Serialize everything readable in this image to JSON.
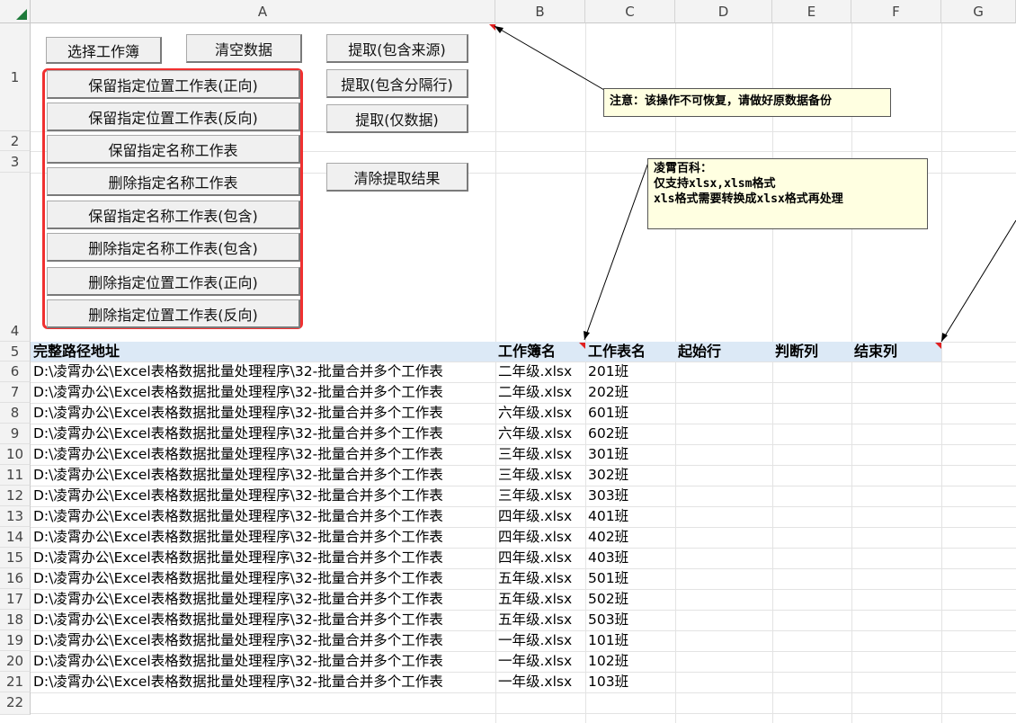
{
  "columns": [
    "A",
    "B",
    "C",
    "D",
    "E",
    "F",
    "G"
  ],
  "rows": [
    "1",
    "2",
    "3",
    "4",
    "5",
    "6",
    "7",
    "8",
    "9",
    "10",
    "11",
    "12",
    "13",
    "14",
    "15",
    "16",
    "17",
    "18",
    "19",
    "20",
    "21",
    "22"
  ],
  "buttons": {
    "select_workbook": "选择工作簿",
    "clear_data": "清空数据",
    "extract_with_source": "提取(包含来源)",
    "extract_with_separator": "提取(包含分隔行)",
    "extract_data_only": "提取(仅数据)",
    "clear_extract_result": "清除提取结果",
    "keep_position_forward": "保留指定位置工作表(正向)",
    "keep_position_reverse": "保留指定位置工作表(反向)",
    "keep_name": "保留指定名称工作表",
    "delete_name": "删除指定名称工作表",
    "keep_name_contains": "保留指定名称工作表(包含)",
    "delete_name_contains": "删除指定名称工作表(包含)",
    "delete_position_forward": "删除指定位置工作表(正向)",
    "delete_position_reverse": "删除指定位置工作表(反向)"
  },
  "notes": {
    "warning": "注意：该操作不可恢复，请做好原数据备份",
    "info": "凌霄百科：\n仅支持xlsx,xlsm格式\nxls格式需要转换成xlsx格式再处理"
  },
  "table": {
    "headers": [
      "完整路径地址",
      "工作簿名",
      "工作表名",
      "起始行",
      "判断列",
      "结束列"
    ],
    "rows": [
      [
        "D:\\凌霄办公\\Excel表格数据批量处理程序\\32-批量合并多个工作表",
        "二年级.xlsx",
        "201班"
      ],
      [
        "D:\\凌霄办公\\Excel表格数据批量处理程序\\32-批量合并多个工作表",
        "二年级.xlsx",
        "202班"
      ],
      [
        "D:\\凌霄办公\\Excel表格数据批量处理程序\\32-批量合并多个工作表",
        "六年级.xlsx",
        "601班"
      ],
      [
        "D:\\凌霄办公\\Excel表格数据批量处理程序\\32-批量合并多个工作表",
        "六年级.xlsx",
        "602班"
      ],
      [
        "D:\\凌霄办公\\Excel表格数据批量处理程序\\32-批量合并多个工作表",
        "三年级.xlsx",
        "301班"
      ],
      [
        "D:\\凌霄办公\\Excel表格数据批量处理程序\\32-批量合并多个工作表",
        "三年级.xlsx",
        "302班"
      ],
      [
        "D:\\凌霄办公\\Excel表格数据批量处理程序\\32-批量合并多个工作表",
        "三年级.xlsx",
        "303班"
      ],
      [
        "D:\\凌霄办公\\Excel表格数据批量处理程序\\32-批量合并多个工作表",
        "四年级.xlsx",
        "401班"
      ],
      [
        "D:\\凌霄办公\\Excel表格数据批量处理程序\\32-批量合并多个工作表",
        "四年级.xlsx",
        "402班"
      ],
      [
        "D:\\凌霄办公\\Excel表格数据批量处理程序\\32-批量合并多个工作表",
        "四年级.xlsx",
        "403班"
      ],
      [
        "D:\\凌霄办公\\Excel表格数据批量处理程序\\32-批量合并多个工作表",
        "五年级.xlsx",
        "501班"
      ],
      [
        "D:\\凌霄办公\\Excel表格数据批量处理程序\\32-批量合并多个工作表",
        "五年级.xlsx",
        "502班"
      ],
      [
        "D:\\凌霄办公\\Excel表格数据批量处理程序\\32-批量合并多个工作表",
        "五年级.xlsx",
        "503班"
      ],
      [
        "D:\\凌霄办公\\Excel表格数据批量处理程序\\32-批量合并多个工作表",
        "一年级.xlsx",
        "101班"
      ],
      [
        "D:\\凌霄办公\\Excel表格数据批量处理程序\\32-批量合并多个工作表",
        "一年级.xlsx",
        "102班"
      ],
      [
        "D:\\凌霄办公\\Excel表格数据批量处理程序\\32-批量合并多个工作表",
        "一年级.xlsx",
        "103班"
      ]
    ]
  }
}
